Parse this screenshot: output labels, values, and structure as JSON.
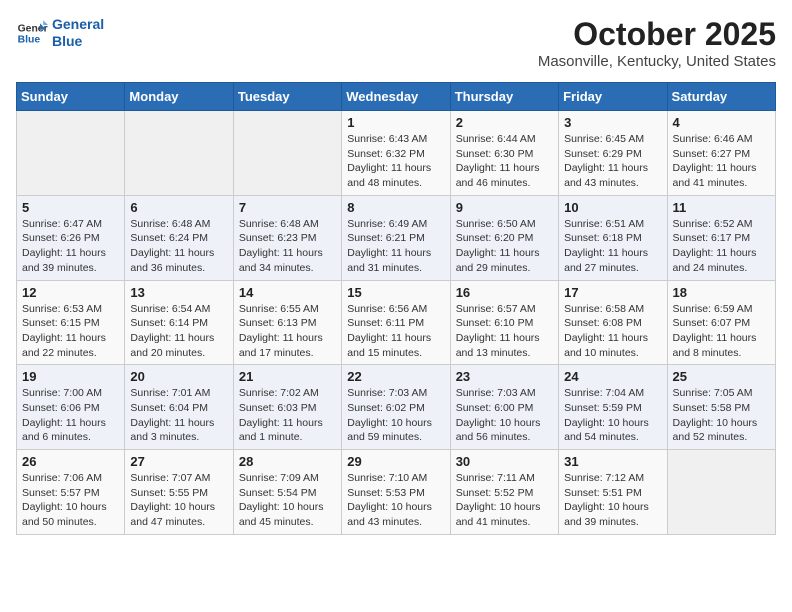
{
  "logo": {
    "line1": "General",
    "line2": "Blue"
  },
  "title": "October 2025",
  "location": "Masonville, Kentucky, United States",
  "weekdays": [
    "Sunday",
    "Monday",
    "Tuesday",
    "Wednesday",
    "Thursday",
    "Friday",
    "Saturday"
  ],
  "weeks": [
    [
      {
        "day": "",
        "info": ""
      },
      {
        "day": "",
        "info": ""
      },
      {
        "day": "",
        "info": ""
      },
      {
        "day": "1",
        "info": "Sunrise: 6:43 AM\nSunset: 6:32 PM\nDaylight: 11 hours\nand 48 minutes."
      },
      {
        "day": "2",
        "info": "Sunrise: 6:44 AM\nSunset: 6:30 PM\nDaylight: 11 hours\nand 46 minutes."
      },
      {
        "day": "3",
        "info": "Sunrise: 6:45 AM\nSunset: 6:29 PM\nDaylight: 11 hours\nand 43 minutes."
      },
      {
        "day": "4",
        "info": "Sunrise: 6:46 AM\nSunset: 6:27 PM\nDaylight: 11 hours\nand 41 minutes."
      }
    ],
    [
      {
        "day": "5",
        "info": "Sunrise: 6:47 AM\nSunset: 6:26 PM\nDaylight: 11 hours\nand 39 minutes."
      },
      {
        "day": "6",
        "info": "Sunrise: 6:48 AM\nSunset: 6:24 PM\nDaylight: 11 hours\nand 36 minutes."
      },
      {
        "day": "7",
        "info": "Sunrise: 6:48 AM\nSunset: 6:23 PM\nDaylight: 11 hours\nand 34 minutes."
      },
      {
        "day": "8",
        "info": "Sunrise: 6:49 AM\nSunset: 6:21 PM\nDaylight: 11 hours\nand 31 minutes."
      },
      {
        "day": "9",
        "info": "Sunrise: 6:50 AM\nSunset: 6:20 PM\nDaylight: 11 hours\nand 29 minutes."
      },
      {
        "day": "10",
        "info": "Sunrise: 6:51 AM\nSunset: 6:18 PM\nDaylight: 11 hours\nand 27 minutes."
      },
      {
        "day": "11",
        "info": "Sunrise: 6:52 AM\nSunset: 6:17 PM\nDaylight: 11 hours\nand 24 minutes."
      }
    ],
    [
      {
        "day": "12",
        "info": "Sunrise: 6:53 AM\nSunset: 6:15 PM\nDaylight: 11 hours\nand 22 minutes."
      },
      {
        "day": "13",
        "info": "Sunrise: 6:54 AM\nSunset: 6:14 PM\nDaylight: 11 hours\nand 20 minutes."
      },
      {
        "day": "14",
        "info": "Sunrise: 6:55 AM\nSunset: 6:13 PM\nDaylight: 11 hours\nand 17 minutes."
      },
      {
        "day": "15",
        "info": "Sunrise: 6:56 AM\nSunset: 6:11 PM\nDaylight: 11 hours\nand 15 minutes."
      },
      {
        "day": "16",
        "info": "Sunrise: 6:57 AM\nSunset: 6:10 PM\nDaylight: 11 hours\nand 13 minutes."
      },
      {
        "day": "17",
        "info": "Sunrise: 6:58 AM\nSunset: 6:08 PM\nDaylight: 11 hours\nand 10 minutes."
      },
      {
        "day": "18",
        "info": "Sunrise: 6:59 AM\nSunset: 6:07 PM\nDaylight: 11 hours\nand 8 minutes."
      }
    ],
    [
      {
        "day": "19",
        "info": "Sunrise: 7:00 AM\nSunset: 6:06 PM\nDaylight: 11 hours\nand 6 minutes."
      },
      {
        "day": "20",
        "info": "Sunrise: 7:01 AM\nSunset: 6:04 PM\nDaylight: 11 hours\nand 3 minutes."
      },
      {
        "day": "21",
        "info": "Sunrise: 7:02 AM\nSunset: 6:03 PM\nDaylight: 11 hours\nand 1 minute."
      },
      {
        "day": "22",
        "info": "Sunrise: 7:03 AM\nSunset: 6:02 PM\nDaylight: 10 hours\nand 59 minutes."
      },
      {
        "day": "23",
        "info": "Sunrise: 7:03 AM\nSunset: 6:00 PM\nDaylight: 10 hours\nand 56 minutes."
      },
      {
        "day": "24",
        "info": "Sunrise: 7:04 AM\nSunset: 5:59 PM\nDaylight: 10 hours\nand 54 minutes."
      },
      {
        "day": "25",
        "info": "Sunrise: 7:05 AM\nSunset: 5:58 PM\nDaylight: 10 hours\nand 52 minutes."
      }
    ],
    [
      {
        "day": "26",
        "info": "Sunrise: 7:06 AM\nSunset: 5:57 PM\nDaylight: 10 hours\nand 50 minutes."
      },
      {
        "day": "27",
        "info": "Sunrise: 7:07 AM\nSunset: 5:55 PM\nDaylight: 10 hours\nand 47 minutes."
      },
      {
        "day": "28",
        "info": "Sunrise: 7:09 AM\nSunset: 5:54 PM\nDaylight: 10 hours\nand 45 minutes."
      },
      {
        "day": "29",
        "info": "Sunrise: 7:10 AM\nSunset: 5:53 PM\nDaylight: 10 hours\nand 43 minutes."
      },
      {
        "day": "30",
        "info": "Sunrise: 7:11 AM\nSunset: 5:52 PM\nDaylight: 10 hours\nand 41 minutes."
      },
      {
        "day": "31",
        "info": "Sunrise: 7:12 AM\nSunset: 5:51 PM\nDaylight: 10 hours\nand 39 minutes."
      },
      {
        "day": "",
        "info": ""
      }
    ]
  ]
}
